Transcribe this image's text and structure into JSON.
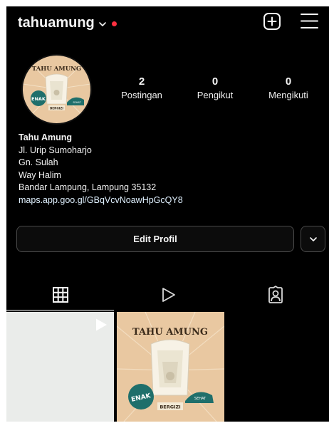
{
  "header": {
    "username": "tahuamung",
    "dot_color": "#ff3040"
  },
  "avatar": {
    "brand": "TAHU AMUNG",
    "badge_left": "ENAK",
    "badge_right": "SEHAT",
    "banner": "BERGIZI"
  },
  "stats": [
    {
      "value": "2",
      "label": "Postingan"
    },
    {
      "value": "0",
      "label": "Pengikut"
    },
    {
      "value": "0",
      "label": "Mengikuti"
    }
  ],
  "bio": {
    "name": "Tahu Amung",
    "lines": [
      "Jl. Urip Sumoharjo",
      "Gn. Sulah",
      "Way Halim",
      "Bandar Lampung, Lampung 35132"
    ],
    "link": "maps.app.goo.gl/GBqVcvNoawHpGcQY8"
  },
  "actions": {
    "edit_label": "Edit Profil"
  },
  "tabs": [
    {
      "icon": "grid-icon",
      "active": true
    },
    {
      "icon": "reels-icon",
      "active": false
    },
    {
      "icon": "tagged-icon",
      "active": false
    }
  ],
  "posts": [
    {
      "type": "reel",
      "icon": "reel-play-icon"
    },
    {
      "type": "image",
      "title": "TAHU AMUNG",
      "badge_left": "ENAK",
      "badge_right": "SEHAT",
      "banner": "BERGIZI"
    }
  ],
  "colors": {
    "background": "#000000",
    "text": "#f5f5f5",
    "poster_bg": "#e9c8a1",
    "poster_teal": "#1f6f6b",
    "link": "#e0f1ff"
  }
}
